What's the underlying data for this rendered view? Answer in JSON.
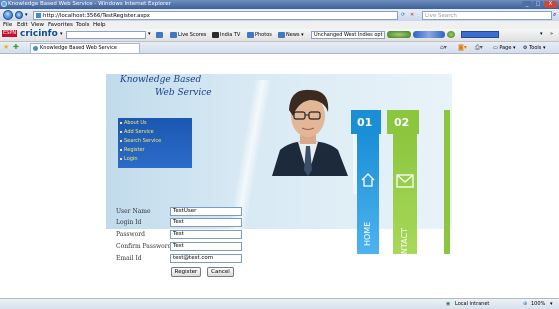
{
  "window": {
    "title": "Knowledge Based Web Service - Windows Internet Explorer",
    "controls": [
      "_",
      "□",
      "X"
    ]
  },
  "address_bar": {
    "url": "http://localhost:3566/TestRegister.aspx",
    "search_placeholder": "Live Search"
  },
  "menu_bar": [
    "File",
    "Edit",
    "View",
    "Favorites",
    "Tools",
    "Help"
  ],
  "toolbar": {
    "brand_prefix": "ESPN",
    "brand_name": "cricinfo",
    "items": [
      "Live Scores",
      "India TV",
      "Photos",
      "News"
    ],
    "match_select": "Unchanged West Indies opt"
  },
  "tab_bar": {
    "tab_title": "Knowledge Based Web Service",
    "commands": [
      "Page",
      "Tools"
    ]
  },
  "banner": {
    "logo_line1": "Knowledge Based",
    "logo_line2": "Web Service",
    "menu_items": [
      "About Us",
      "Add Service",
      "Search Service",
      "Register",
      "Login"
    ],
    "tiles": [
      {
        "number": "01",
        "label": "HOME",
        "icon": "home-icon"
      },
      {
        "number": "02",
        "label": "CONTACT",
        "icon": "envelope-icon"
      }
    ]
  },
  "form": {
    "fields": [
      {
        "label": "User Name",
        "value": "TestUser"
      },
      {
        "label": "Login Id",
        "value": "Test"
      },
      {
        "label": "Password",
        "value": "Test"
      },
      {
        "label": "Confirm Password",
        "value": "Test"
      },
      {
        "label": "Email Id",
        "value": "test@test.com"
      }
    ],
    "register_label": "Register",
    "cancel_label": "Cancel"
  },
  "status_bar": {
    "zone": "Local intranet",
    "zoom": "100%"
  },
  "colors": {
    "banner_blue": "#1f5fbd",
    "tile_green": "#8cc63f",
    "tile_blue": "#1b8fd6",
    "logo_text": "#1b3f88"
  }
}
